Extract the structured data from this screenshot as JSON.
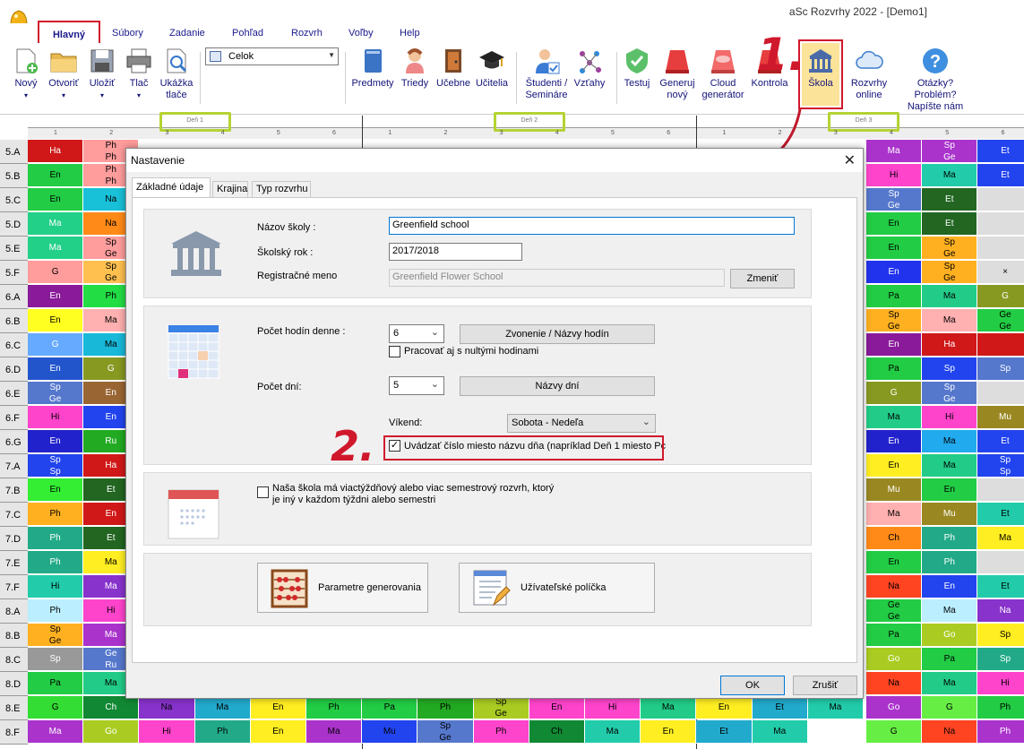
{
  "window": {
    "title": "aSc Rozvrhy 2022  - [Demo1]"
  },
  "menu": {
    "tabs": [
      {
        "label": "Hlavný",
        "active": true
      },
      {
        "label": "Súbory"
      },
      {
        "label": "Zadanie"
      },
      {
        "label": "Pohľad"
      },
      {
        "label": "Rozvrh"
      },
      {
        "label": "Voľby"
      },
      {
        "label": "Help"
      }
    ]
  },
  "ribbon": {
    "file_buttons": [
      {
        "label": "Nový",
        "icon": "new-file-icon"
      },
      {
        "label": "Otvoriť",
        "icon": "folder-open-icon"
      },
      {
        "label": "Uložiť",
        "icon": "save-icon"
      },
      {
        "label": "Tlač",
        "icon": "printer-icon"
      },
      {
        "label": "Ukážka tlače",
        "icon": "print-preview-icon"
      }
    ],
    "view_combo": "Celok",
    "data_buttons": [
      {
        "label": "Predmety",
        "icon": "book-icon"
      },
      {
        "label": "Triedy",
        "icon": "students-icon"
      },
      {
        "label": "Učebne",
        "icon": "door-icon"
      },
      {
        "label": "Učitelia",
        "icon": "graduation-cap-icon"
      },
      {
        "label": "Študenti / Semináre",
        "icon": "student-check-icon"
      },
      {
        "label": "Vzťahy",
        "icon": "relations-icon"
      },
      {
        "label": "Testuj",
        "icon": "check-shield-icon"
      },
      {
        "label": "Generuj nový",
        "icon": "generate-icon"
      },
      {
        "label": "Cloud generátor",
        "icon": "cloud-generate-icon"
      },
      {
        "label": "Kontrola",
        "icon": "control-icon"
      },
      {
        "label": "Škola",
        "icon": "school-building-icon"
      },
      {
        "label": "Rozvrhy online",
        "icon": "cloud-icon"
      },
      {
        "label": "Otázky? Problém? Napíšte nám",
        "icon": "question-icon"
      }
    ]
  },
  "annotations": {
    "step1": "1.",
    "step2": "2."
  },
  "grid": {
    "days": [
      "Deň 1",
      "Deň 2",
      "Deň 3"
    ],
    "periods": [
      "1",
      "2",
      "3",
      "4",
      "5",
      "6"
    ],
    "classes": [
      "5.A",
      "5.B",
      "5.C",
      "5.D",
      "5.E",
      "5.F",
      "6.A",
      "6.B",
      "6.C",
      "6.D",
      "6.E",
      "6.F",
      "6.G",
      "7.A",
      "7.B",
      "7.C",
      "7.D",
      "7.E",
      "7.F",
      "8.A",
      "8.B",
      "8.C",
      "8.D",
      "8.E",
      "8.F"
    ],
    "left_cells": [
      [
        [
          "Ha",
          "#d01818"
        ],
        [
          "Ph/Ph",
          "#ff9c9c"
        ]
      ],
      [
        [
          "En",
          "#22cc44"
        ],
        [
          "Ph/Ph",
          "#ff9c9c"
        ]
      ],
      [
        [
          "En",
          "#22cc44"
        ],
        [
          "Na",
          "#18c0d8"
        ]
      ],
      [
        [
          "Ma",
          "#22d088"
        ],
        [
          "Na",
          "#ff8a18"
        ]
      ],
      [
        [
          "Ma",
          "#22d088"
        ],
        [
          "Sp/Ge",
          "#ff9c9c"
        ]
      ],
      [
        [
          "G",
          "#ff9c9c"
        ],
        [
          "Sp/Ge",
          "#ffc050"
        ]
      ],
      [
        [
          "En",
          "#8a1a9a"
        ],
        [
          "Ph",
          "#22dd44"
        ]
      ],
      [
        [
          "En",
          "#ffff22"
        ],
        [
          "Ma",
          "#ffb0b0"
        ]
      ],
      [
        [
          "G",
          "#66aaff"
        ],
        [
          "Ma",
          "#18b8d8"
        ]
      ],
      [
        [
          "En",
          "#2255cc"
        ],
        [
          "G",
          "#889922"
        ]
      ],
      [
        [
          "Sp/Ge",
          "#5577cc"
        ],
        [
          "En",
          "#996633"
        ]
      ],
      [
        [
          "Hi",
          "#ff44cc"
        ],
        [
          "En",
          "#2244ee"
        ]
      ],
      [
        [
          "En",
          "#2222cc"
        ],
        [
          "Ru",
          "#22aa22"
        ]
      ],
      [
        [
          "Sp/Sp",
          "#2244ee"
        ],
        [
          "Ha",
          "#d01818"
        ]
      ],
      [
        [
          "En",
          "#33ee33"
        ],
        [
          "Et",
          "#226622"
        ]
      ],
      [
        [
          "Ph",
          "#ffb020"
        ],
        [
          "En",
          "#d01818"
        ]
      ],
      [
        [
          "Ph",
          "#22aa88"
        ],
        [
          "Et",
          "#226622"
        ]
      ],
      [
        [
          "Ph",
          "#22aa88"
        ],
        [
          "Ma",
          "#ffee22"
        ]
      ],
      [
        [
          "Hi",
          "#22ccaa"
        ],
        [
          "Ma",
          "#8833cc"
        ]
      ],
      [
        [
          "Ph",
          "#bbeeff"
        ],
        [
          "Hi",
          "#ff44cc"
        ]
      ],
      [
        [
          "Sp/Ge",
          "#ffb020"
        ],
        [
          "Ma",
          "#aa33cc"
        ]
      ],
      [
        [
          "Sp",
          "#999999"
        ],
        [
          "Ge/Ru",
          "#5577cc"
        ]
      ],
      [
        [
          "Pa",
          "#22cc44"
        ],
        [
          "Ma",
          "#22cc88"
        ]
      ],
      [
        [
          "G",
          "#33dd33"
        ],
        [
          "Ch",
          "#118833"
        ]
      ],
      [
        [
          "Ma",
          "#aa33cc"
        ],
        [
          "Go",
          "#aacc22"
        ]
      ]
    ],
    "right_cells": [
      [
        [
          "Ma",
          "#aa33cc"
        ],
        [
          "Sp/Ge",
          "#aa33cc"
        ],
        [
          "Et",
          "#2244ee"
        ]
      ],
      [
        [
          "Hi",
          "#ff44cc"
        ],
        [
          "Ma",
          "#22ccaa"
        ],
        [
          "Et",
          "#2244ee"
        ]
      ],
      [
        [
          "Sp/Ge",
          "#5577cc"
        ],
        [
          "Et",
          "#226622"
        ],
        [
          "",
          "#dddddd"
        ]
      ],
      [
        [
          "En",
          "#22cc44"
        ],
        [
          "Et",
          "#226622"
        ],
        [
          "",
          "#dddddd"
        ]
      ],
      [
        [
          "En",
          "#22cc44"
        ],
        [
          "Sp/Ge",
          "#ffb020"
        ],
        [
          "",
          "#dddddd"
        ]
      ],
      [
        [
          "En",
          "#2233ee"
        ],
        [
          "Sp/Ge",
          "#ffb020"
        ],
        [
          "×",
          "#dddddd"
        ]
      ],
      [
        [
          "Pa",
          "#22cc44"
        ],
        [
          "Ma",
          "#22cc88"
        ],
        [
          "G",
          "#889922"
        ]
      ],
      [
        [
          "Sp/Ge",
          "#ffb020"
        ],
        [
          "Ma",
          "#ffb0b0"
        ],
        [
          "Ge/Ge",
          "#22cc44"
        ]
      ],
      [
        [
          "En",
          "#8a1a9a"
        ],
        [
          "Ha",
          "#d01818"
        ],
        [
          "",
          "#d01818"
        ]
      ],
      [
        [
          "Pa",
          "#22cc44"
        ],
        [
          "Sp",
          "#2244ee"
        ],
        [
          "Sp",
          "#5577cc"
        ]
      ],
      [
        [
          "G",
          "#889922"
        ],
        [
          "Sp/Ge",
          "#5577cc"
        ],
        [
          "",
          "#dddddd"
        ]
      ],
      [
        [
          "Ma",
          "#22cc88"
        ],
        [
          "Hi",
          "#ff44cc"
        ],
        [
          "Mu",
          "#998822"
        ]
      ],
      [
        [
          "En",
          "#2222cc"
        ],
        [
          "Ma",
          "#22aaee"
        ],
        [
          "Et",
          "#2244ee"
        ]
      ],
      [
        [
          "En",
          "#ffee22"
        ],
        [
          "Ma",
          "#22cc88"
        ],
        [
          "Sp/Sp",
          "#2244ee"
        ]
      ],
      [
        [
          "Mu",
          "#998822"
        ],
        [
          "En",
          "#22cc44"
        ],
        [
          "",
          "#dddddd"
        ]
      ],
      [
        [
          "Ma",
          "#ffb0b0"
        ],
        [
          "Mu",
          "#998822"
        ],
        [
          "Et",
          "#22ccaa"
        ]
      ],
      [
        [
          "Ch",
          "#ff8a18"
        ],
        [
          "Ph",
          "#22aa88"
        ],
        [
          "Ma",
          "#ffee22"
        ]
      ],
      [
        [
          "En",
          "#22cc44"
        ],
        [
          "Ph",
          "#22aa88"
        ],
        [
          "",
          "#dddddd"
        ]
      ],
      [
        [
          "Na",
          "#ff4422"
        ],
        [
          "En",
          "#2244ee"
        ],
        [
          "Et",
          "#22ccaa"
        ]
      ],
      [
        [
          "Ge/Ge",
          "#22cc44"
        ],
        [
          "Ma",
          "#bbeeff"
        ],
        [
          "Na",
          "#8833cc"
        ]
      ],
      [
        [
          "Pa",
          "#22cc44"
        ],
        [
          "Go",
          "#aacc22"
        ],
        [
          "Sp",
          "#ffee22"
        ]
      ],
      [
        [
          "Go",
          "#aacc22"
        ],
        [
          "Pa",
          "#22cc44"
        ],
        [
          "Sp",
          "#22aa88"
        ]
      ],
      [
        [
          "Na",
          "#ff4422"
        ],
        [
          "Ma",
          "#22cc88"
        ],
        [
          "Hi",
          "#ff44cc"
        ]
      ],
      [
        [
          "Go",
          "#aa33cc"
        ],
        [
          "G",
          "#66ee44"
        ],
        [
          "Ph",
          "#22cc44"
        ]
      ],
      [
        [
          "G",
          "#66ee44"
        ],
        [
          "Na",
          "#ff4422"
        ],
        [
          "Ph",
          "#aa33cc"
        ]
      ]
    ],
    "bottom_strip": [
      [
        "Na",
        "#8833cc"
      ],
      [
        "Ma",
        "#22aacc"
      ],
      [
        "En",
        "#ffee22"
      ],
      [
        "Ph",
        "#22cc44"
      ],
      [
        "Pa",
        "#22cc44"
      ],
      [
        "Ph",
        "#22aa22"
      ],
      [
        "Sp/Ge",
        "#aacc22"
      ],
      [
        "En",
        "#ff44cc"
      ],
      [
        "Hi",
        "#ff44cc"
      ],
      [
        "Ma",
        "#22cc88"
      ],
      [
        "En",
        "#ffee22"
      ],
      [
        "Et",
        "#22aacc"
      ],
      [
        "Ma",
        "#22ccaa"
      ],
      [
        "Hi",
        "#ff44cc"
      ],
      [
        "Ph",
        "#22aa88"
      ],
      [
        "En",
        "#ffee22"
      ],
      [
        "Ma",
        "#aa33cc"
      ],
      [
        "Mu",
        "#2244ee"
      ],
      [
        "Sp/Ge",
        "#5577cc"
      ],
      [
        "Ph",
        "#ff44cc"
      ],
      [
        "Ch",
        "#118833"
      ],
      [
        "Ma",
        "#22ccaa"
      ],
      [
        "En",
        "#ffee22"
      ],
      [
        "Et",
        "#22aacc"
      ],
      [
        "Ma",
        "#22ccaa"
      ]
    ]
  },
  "dialog": {
    "title": "Nastavenie",
    "tabs": [
      "Základné údaje",
      "Krajina",
      "Typ rozvrhu"
    ],
    "school_name_label": "Názov školy :",
    "school_name_value": "Greenfield school",
    "school_year_label": "Školský rok :",
    "school_year_value": "2017/2018",
    "reg_name_label": "Registračné meno",
    "reg_name_value": "Greenfield Flower School",
    "change_button": "Zmeniť",
    "hours_label": "Počet hodín denne :",
    "hours_value": "6",
    "bells_button": "Zvonenie / Názvy hodín",
    "zero_hours_label": "Pracovať aj s nultými hodinami",
    "days_label": "Počet dní:",
    "days_value": "5",
    "day_names_button": "Názvy dní",
    "weekend_label": "Víkend:",
    "weekend_value": "Sobota - Nedeľa",
    "day_number_label": "Uvádzať číslo miesto názvu dňa (napríklad Deň 1 miesto Pc",
    "multiweek_label_1": "Naša škola má viactýždňový alebo viac semestrový rozvrh, ktorý",
    "multiweek_label_2": "je iný v každom týždni alebo semestri",
    "gen_params_button": "Parametre generovania",
    "user_fields_button": "Užívateľské políčka",
    "ok_button": "OK",
    "cancel_button": "Zrušiť"
  }
}
